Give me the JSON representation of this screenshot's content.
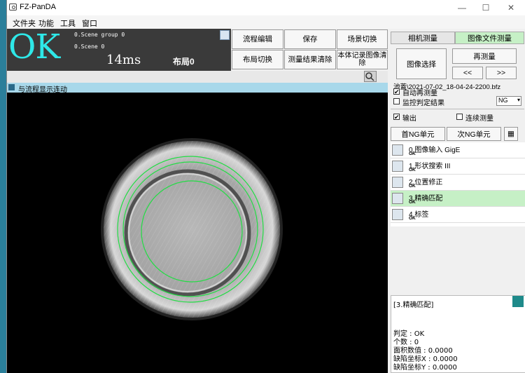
{
  "window": {
    "title": "FZ-PanDA",
    "minimize": "—",
    "maximize": "☐",
    "close": "✕"
  },
  "menu": [
    "文件夹",
    "功能",
    "工具",
    "窗口"
  ],
  "status": {
    "judgement": "OK",
    "scene_group": "0.Scene group 0",
    "scene": "0.Scene 0",
    "time": "14ms",
    "layout": "布局0",
    "judgement_color": "#2ee8e8"
  },
  "toolbar_buttons": {
    "flow_edit": "流程编辑",
    "save": "保存",
    "scene_switch": "场景切换",
    "layout_switch": "布局切换",
    "clear_results": "测量结果清除",
    "clear_images": "本体记录图像清除"
  },
  "image_panel": {
    "flow_sync_label": "与流程显示连动"
  },
  "right_panel": {
    "tabs": [
      "相机测量",
      "图像文件测量"
    ],
    "select_image": "图像选择",
    "remeasure": "再测量",
    "prev": "<<",
    "next": ">>",
    "file_path": "池蓋\\2021-07-02_18-04-24-2200.bfz",
    "auto_remeasure": "自动再测量",
    "monitor_result": "监控判定结果",
    "monitor_value": "NG",
    "output": "输出",
    "continuous": "连续测量",
    "first_ng": "首NG单元",
    "next_ng": "次NG单元"
  },
  "units": [
    {
      "title": "0.图像输入 GigE",
      "status": "OK",
      "icon": "camera-icon"
    },
    {
      "title": "1.形状搜索 III",
      "status": "OK",
      "icon": "shape-search-icon"
    },
    {
      "title": "2.位置修正",
      "status": "OK",
      "icon": "position-correct-icon"
    },
    {
      "title": "3.精确匹配",
      "status": "OK",
      "icon": "precise-match-icon"
    },
    {
      "title": "4.标签",
      "status": "OK",
      "icon": "label-icon"
    }
  ],
  "detail": {
    "header": "[3.精确匹配]",
    "lines": [
      "判定 : OK",
      "个数 : 0",
      "面积数值 : 0.0000",
      "缺陷坐标X : 0.0000",
      "缺陷坐标Y : 0.0000"
    ]
  }
}
